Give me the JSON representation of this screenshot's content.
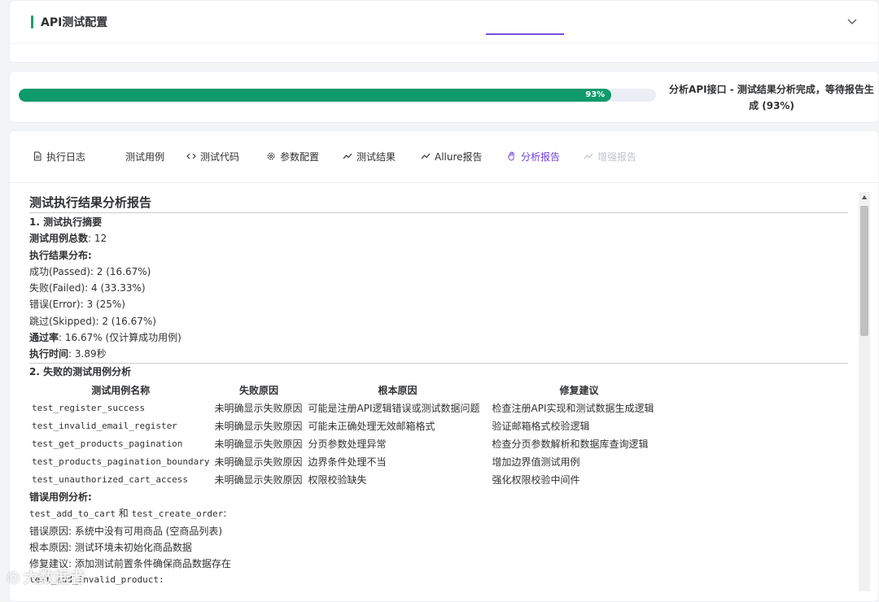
{
  "config": {
    "title": "API测试配置"
  },
  "progress": {
    "percent": 93,
    "percent_label": "93%",
    "status": "分析API接口 - 测试结果分析完成，等待报告生成 (93%)"
  },
  "tabs": [
    {
      "label": "执行日志",
      "icon": "document-icon"
    },
    {
      "label": "测试用例",
      "icon": ""
    },
    {
      "label": "测试代码",
      "icon": "code-icon"
    },
    {
      "label": "参数配置",
      "icon": "gear-icon"
    },
    {
      "label": "测试结果",
      "icon": "trend-icon"
    },
    {
      "label": "Allure报告",
      "icon": "trend-icon"
    },
    {
      "label": "分析报告",
      "icon": "hand-icon"
    },
    {
      "label": "增强报告",
      "icon": "trend-icon"
    }
  ],
  "report": {
    "title": "测试执行结果分析报告",
    "s1_heading": "1. 测试执行摘要",
    "total_label": "测试用例总数",
    "total_value": ": 12",
    "dist_label": "执行结果分布:",
    "passed": "成功(Passed): 2 (16.67%)",
    "failed": "失败(Failed): 4 (33.33%)",
    "error": "错误(Error): 3 (25%)",
    "skipped": "跳过(Skipped): 2 (16.67%)",
    "pass_rate_label": "通过率",
    "pass_rate_value": ": 16.67% (仅计算成功用例)",
    "exec_time_label": "执行时间",
    "exec_time_value": ": 3.89秒",
    "s2_heading": "2. 失败的测试用例分析",
    "table_headers": [
      "测试用例名称",
      "失败原因",
      "根本原因",
      "修复建议"
    ],
    "table_rows": [
      [
        "test_register_success",
        "未明确显示失败原因",
        "可能是注册API逻辑错误或测试数据问题",
        "检查注册API实现和测试数据生成逻辑"
      ],
      [
        "test_invalid_email_register",
        "未明确显示失败原因",
        "可能未正确处理无效邮箱格式",
        "验证邮箱格式校验逻辑"
      ],
      [
        "test_get_products_pagination",
        "未明确显示失败原因",
        "分页参数处理异常",
        "检查分页参数解析和数据库查询逻辑"
      ],
      [
        "test_products_pagination_boundary",
        "未明确显示失败原因",
        "边界条件处理不当",
        "增加边界值测试用例"
      ],
      [
        "test_unauthorized_cart_access",
        "未明确显示失败原因",
        "权限校验缺失",
        "强化权限校验中间件"
      ]
    ],
    "error_heading": "错误用例分析:",
    "error_case_prefix": "test_add_to_cart",
    "error_case_and": " 和 ",
    "error_case_suffix": "test_create_order",
    "error_case_colon": ":",
    "error_reason": "错误原因: 系统中没有可用商品 (空商品列表)",
    "root_cause": "根本原因: 测试环境未初始化商品数据",
    "fix_suggestion": "修复建议: 添加测试前置条件确保商品数据存在",
    "next_case": "test_add_invalid_product:"
  },
  "watermark": "大数据者"
}
